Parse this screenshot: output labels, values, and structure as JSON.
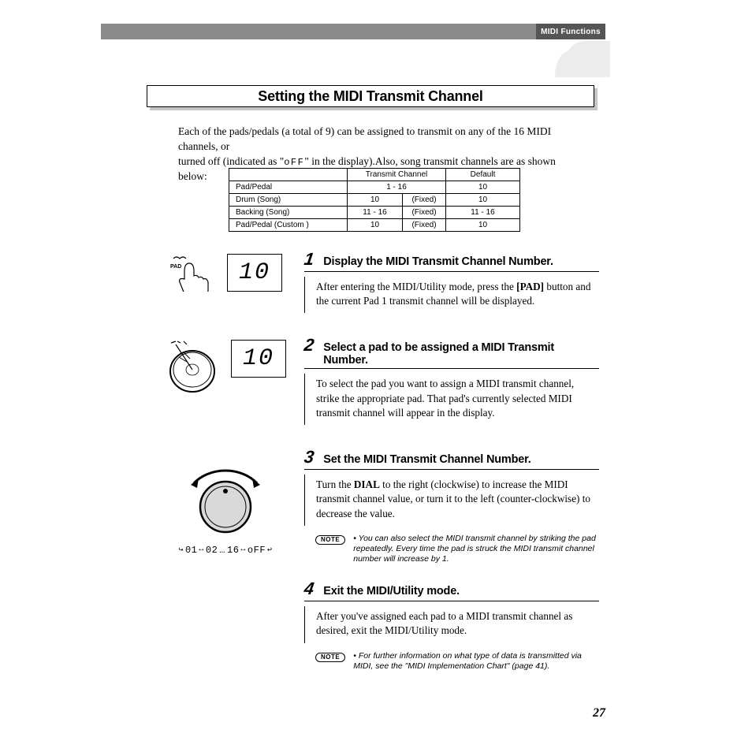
{
  "header": {
    "tab": "MIDI Functions"
  },
  "section_title": "Setting the MIDI Transmit Channel",
  "intro": {
    "line1": "Each of the pads/pedals (a total of 9) can be assigned to transmit on any of the 16 MIDI channels, or",
    "line2a": "turned off (indicated as \"",
    "off_token": "oFF",
    "line2b": "\" in the display).Also, song transmit channels are as shown below:"
  },
  "table": {
    "headers": [
      "",
      "Transmit Channel",
      "Default"
    ],
    "rows": [
      {
        "name": "Pad/Pedal",
        "tc": "1 - 16",
        "fixed": "",
        "def": "10"
      },
      {
        "name": "Drum (Song)",
        "tc": "10",
        "fixed": "(Fixed)",
        "def": "10"
      },
      {
        "name": "Backing (Song)",
        "tc": "11 - 16",
        "fixed": "(Fixed)",
        "def": "11 - 16"
      },
      {
        "name": "Pad/Pedal (Custom )",
        "tc": "10",
        "fixed": "(Fixed)",
        "def": "10"
      }
    ]
  },
  "steps": [
    {
      "num": "1",
      "title": "Display the MIDI Transmit Channel Number.",
      "lcd": "10",
      "body_a": "After entering the MIDI/Utility mode, press the ",
      "bold": "[PAD]",
      "body_b": " button and the current Pad 1 transmit channel will be displayed."
    },
    {
      "num": "2",
      "title": "Select a pad to be assigned a MIDI Transmit Number.",
      "lcd": "10",
      "body": "To select the pad you want to assign a MIDI transmit channel, strike the appropriate pad. That pad's currently selected MIDI transmit channel will appear in the display."
    },
    {
      "num": "3",
      "title": "Set the MIDI Transmit Channel Number.",
      "body_a": "Turn the ",
      "bold": "DIAL",
      "body_b": " to the right (clockwise) to increase the MIDI transmit channel value, or turn it to the left (counter-clockwise) to decrease the value.",
      "dial_values": [
        "01",
        "02",
        "…",
        "16",
        "oFF"
      ],
      "note": "You can also select the MIDI transmit channel by striking the pad repeatedly. Every time the pad is struck the MIDI transmit channel number will increase by 1."
    },
    {
      "num": "4",
      "title": "Exit the MIDI/Utility mode.",
      "body": "After you've assigned each pad to a MIDI transmit channel as desired, exit the MIDI/Utility mode.",
      "note": "For further information on what type of data is transmitted via MIDI, see the \"MIDI Implementation Chart\" (page 41)."
    }
  ],
  "note_label": "NOTE",
  "page_number": "27"
}
